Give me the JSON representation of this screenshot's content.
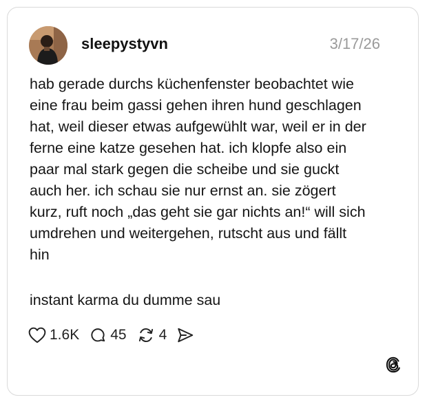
{
  "post": {
    "username": "sleepystyvn",
    "date": "3/17/26",
    "body": "hab gerade durchs küchenfenster beobachtet wie\neine frau beim gassi gehen ihren hund geschlagen\nhat, weil dieser etwas aufgewühlt war, weil er in der\nferne eine katze gesehen hat. ich klopfe also ein\npaar mal stark gegen die scheibe und sie guckt\nauch her. ich schau sie nur ernst an. sie zögert\nkurz, ruft noch „das geht sie gar nichts an!“ will sich\numdrehen und weitergehen, rutscht aus und fällt\nhin",
    "closing": "instant karma du dumme sau"
  },
  "actions": {
    "likes": "1.6K",
    "replies": "45",
    "reposts": "4"
  },
  "icons": {
    "like": "heart-icon",
    "reply": "comment-bubble-icon",
    "repost": "repost-icon",
    "share": "send-icon",
    "brand": "threads-logo-icon"
  },
  "colors": {
    "text": "#151515",
    "date": "#9a9a9a",
    "border": "#d9d9d9"
  }
}
